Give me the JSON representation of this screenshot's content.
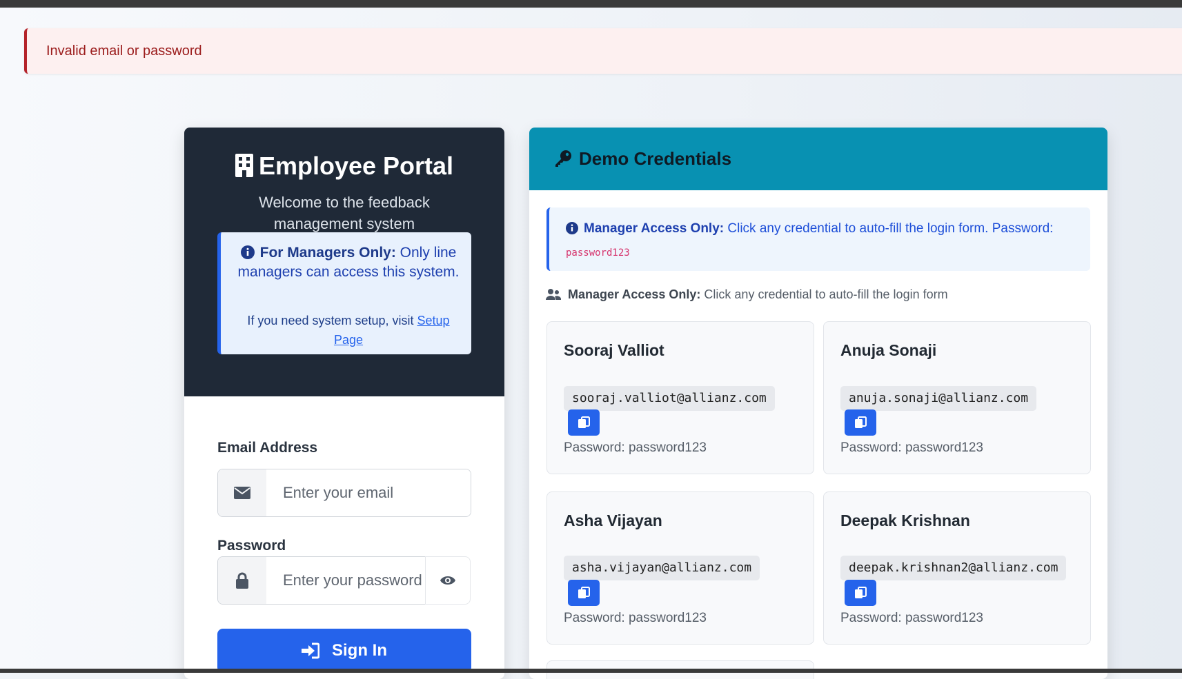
{
  "alert": {
    "message": "Invalid email or password"
  },
  "login": {
    "title": "Employee Portal",
    "subtitle": "Welcome to the feedback management system",
    "notice": {
      "heading": "For Managers Only:",
      "text": " Only line managers can access this system.",
      "setup_prefix": "If you need system setup, visit ",
      "setup_link": "Setup Page"
    },
    "email_label": "Email Address",
    "email_placeholder": "Enter your email",
    "password_label": "Password",
    "password_placeholder": "Enter your password",
    "signin_label": "Sign In"
  },
  "credentials": {
    "title": "Demo Credentials",
    "info_heading": "Manager Access Only:",
    "info_text": " Click any credential to auto-fill the login form. Password:",
    "info_password": "password123",
    "access_heading": "Manager Access Only:",
    "access_text": " Click any credential to auto-fill the login form",
    "users": [
      {
        "name": "Sooraj Valliot",
        "email": "sooraj.valliot@allianz.com",
        "password": "Password: password123"
      },
      {
        "name": "Anuja Sonaji",
        "email": "anuja.sonaji@allianz.com",
        "password": "Password: password123"
      },
      {
        "name": "Asha Vijayan",
        "email": "asha.vijayan@allianz.com",
        "password": "Password: password123"
      },
      {
        "name": "Deepak Krishnan",
        "email": "deepak.krishnan2@allianz.com",
        "password": "Password: password123"
      }
    ]
  },
  "icons": {
    "brand": "building-icon",
    "notice": "info-circle-icon",
    "email": "envelope-icon",
    "password": "lock-icon",
    "toggle": "eye-icon",
    "signin": "sign-in-icon",
    "credentials": "key-icon",
    "access": "users-icon",
    "copy": "copy-icon"
  },
  "colors": {
    "primary": "#2563eb",
    "header_dark": "#1f2937",
    "header_teal": "#0891b2",
    "alert_text": "#9b1c1c",
    "code_pink": "#d6336c"
  }
}
